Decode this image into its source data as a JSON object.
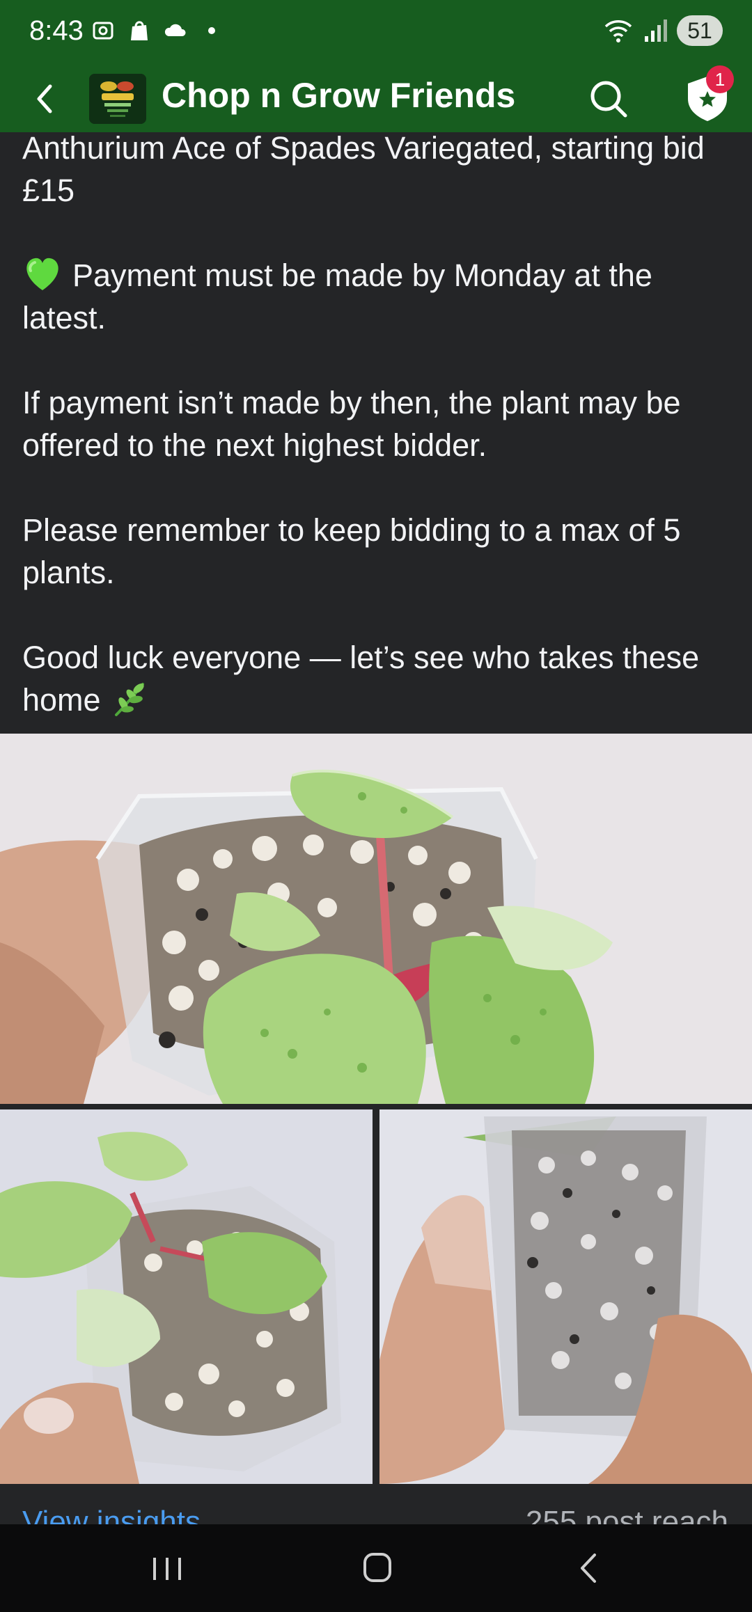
{
  "status_bar": {
    "time": "8:43",
    "battery": "51"
  },
  "header": {
    "title": "Chop n Grow Friends",
    "notification_count": "1"
  },
  "post": {
    "paragraphs": [
      "Anthurium Ace of Spades Variegated,  starting bid £15",
      "Payment must be made by Monday at the latest.",
      "If payment isn’t made by then, the plant may be offered to the next highest bidder.",
      "Please remember to keep bidding to a max of 5 plants.",
      "Good luck everyone — let’s see who takes these home"
    ],
    "emoji_heart": "green-heart-emoji",
    "emoji_herb": "herb-emoji"
  },
  "footer": {
    "view_insights": "View insights",
    "post_reach": "255 post reach"
  },
  "colors": {
    "header_green": "#175d1f",
    "background": "#242527",
    "link_blue": "#4a9cf0",
    "badge_red": "#e0244a"
  }
}
